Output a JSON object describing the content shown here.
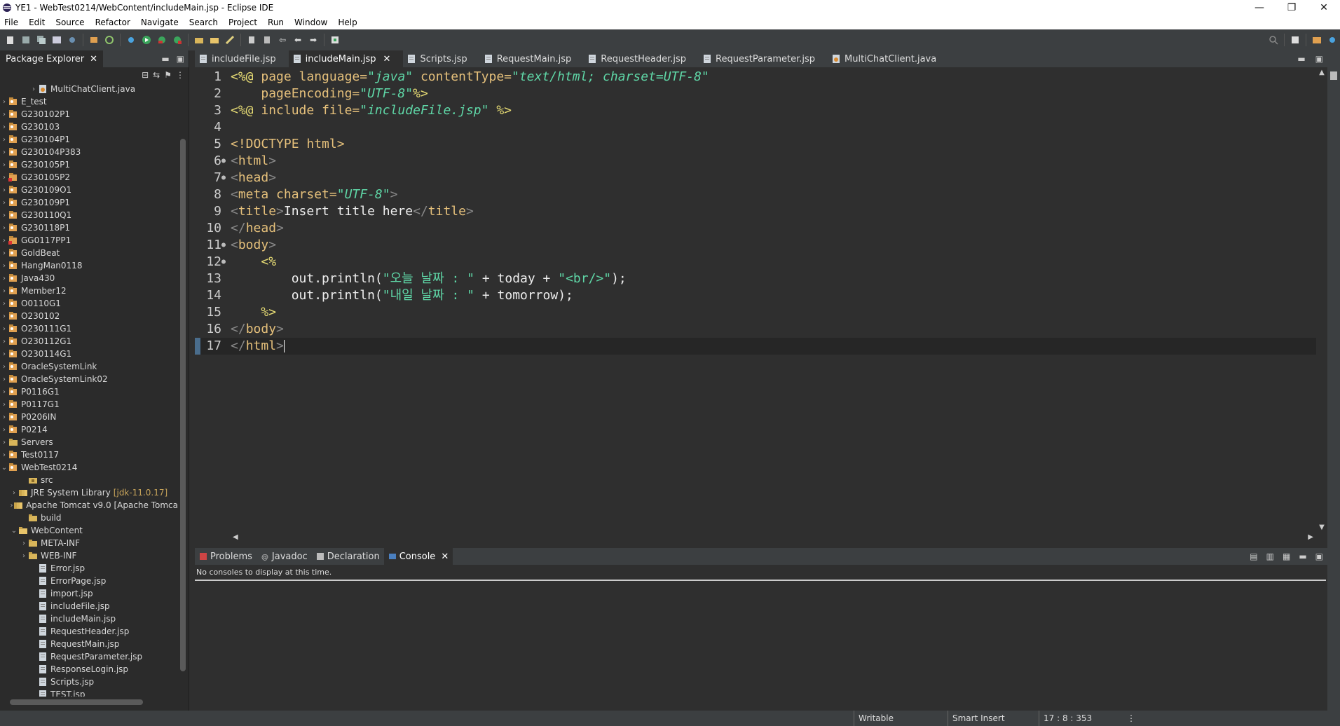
{
  "window": {
    "title": "YE1 - WebTest0214/WebContent/includeMain.jsp - Eclipse IDE",
    "controls": {
      "minimize": "—",
      "restore": "❐",
      "close": "✕"
    }
  },
  "menu": [
    "File",
    "Edit",
    "Source",
    "Refactor",
    "Navigate",
    "Search",
    "Project",
    "Run",
    "Window",
    "Help"
  ],
  "explorer": {
    "tab_label": "Package Explorer",
    "close_glyph": "✕",
    "tree": [
      {
        "label": "MultiChatClient.java",
        "indent": 3,
        "arrow": "›",
        "icon": "java-file-icon"
      },
      {
        "label": "E_test",
        "indent": 0,
        "arrow": "›",
        "icon": "project-icon"
      },
      {
        "label": "G230102P1",
        "indent": 0,
        "arrow": "›",
        "icon": "project-icon"
      },
      {
        "label": "G230103",
        "indent": 0,
        "arrow": "›",
        "icon": "project-icon"
      },
      {
        "label": "G230104P1",
        "indent": 0,
        "arrow": "›",
        "icon": "project-icon"
      },
      {
        "label": "G230104P383",
        "indent": 0,
        "arrow": "›",
        "icon": "project-icon"
      },
      {
        "label": "G230105P1",
        "indent": 0,
        "arrow": "›",
        "icon": "project-icon"
      },
      {
        "label": "G230105P2",
        "indent": 0,
        "arrow": "›",
        "icon": "project-error-icon"
      },
      {
        "label": "G230109O1",
        "indent": 0,
        "arrow": "›",
        "icon": "project-icon"
      },
      {
        "label": "G230109P1",
        "indent": 0,
        "arrow": "›",
        "icon": "project-icon"
      },
      {
        "label": "G230110Q1",
        "indent": 0,
        "arrow": "›",
        "icon": "project-icon"
      },
      {
        "label": "G230118P1",
        "indent": 0,
        "arrow": "›",
        "icon": "project-icon"
      },
      {
        "label": "GG0117PP1",
        "indent": 0,
        "arrow": "›",
        "icon": "project-error-icon"
      },
      {
        "label": "GoldBeat",
        "indent": 0,
        "arrow": "›",
        "icon": "project-icon"
      },
      {
        "label": "HangMan0118",
        "indent": 0,
        "arrow": "›",
        "icon": "project-icon"
      },
      {
        "label": "Java430",
        "indent": 0,
        "arrow": "›",
        "icon": "project-icon"
      },
      {
        "label": "Member12",
        "indent": 0,
        "arrow": "›",
        "icon": "project-icon"
      },
      {
        "label": "O0110G1",
        "indent": 0,
        "arrow": "›",
        "icon": "project-icon"
      },
      {
        "label": "O230102",
        "indent": 0,
        "arrow": "›",
        "icon": "project-icon"
      },
      {
        "label": "O230111G1",
        "indent": 0,
        "arrow": "›",
        "icon": "project-icon"
      },
      {
        "label": "O230112G1",
        "indent": 0,
        "arrow": "›",
        "icon": "project-icon"
      },
      {
        "label": "O230114G1",
        "indent": 0,
        "arrow": "›",
        "icon": "project-icon"
      },
      {
        "label": "OracleSystemLink",
        "indent": 0,
        "arrow": "›",
        "icon": "project-icon"
      },
      {
        "label": "OracleSystemLink02",
        "indent": 0,
        "arrow": "›",
        "icon": "project-icon"
      },
      {
        "label": "P0116G1",
        "indent": 0,
        "arrow": "›",
        "icon": "project-icon"
      },
      {
        "label": "P0117G1",
        "indent": 0,
        "arrow": "›",
        "icon": "project-icon"
      },
      {
        "label": "P0206IN",
        "indent": 0,
        "arrow": "›",
        "icon": "project-icon"
      },
      {
        "label": "P0214",
        "indent": 0,
        "arrow": "›",
        "icon": "project-icon"
      },
      {
        "label": "Servers",
        "indent": 0,
        "arrow": "›",
        "icon": "folder-icon"
      },
      {
        "label": "Test0117",
        "indent": 0,
        "arrow": "›",
        "icon": "project-icon"
      },
      {
        "label": "WebTest0214",
        "indent": 0,
        "arrow": "⌄",
        "icon": "project-icon"
      },
      {
        "label": "src",
        "indent": 2,
        "arrow": "",
        "icon": "package-folder-icon"
      },
      {
        "label": "JRE System Library",
        "decor": "[jdk-11.0.17]",
        "indent": 1,
        "arrow": "›",
        "icon": "library-icon"
      },
      {
        "label": "Apache Tomcat v9.0 [Apache Tomca",
        "indent": 1,
        "arrow": "›",
        "icon": "library-icon"
      },
      {
        "label": "build",
        "indent": 2,
        "arrow": "",
        "icon": "folder-icon"
      },
      {
        "label": "WebContent",
        "indent": 1,
        "arrow": "⌄",
        "icon": "folder-open-icon"
      },
      {
        "label": "META-INF",
        "indent": 2,
        "arrow": "›",
        "icon": "folder-icon"
      },
      {
        "label": "WEB-INF",
        "indent": 2,
        "arrow": "›",
        "icon": "folder-icon"
      },
      {
        "label": "Error.jsp",
        "indent": 3,
        "arrow": "",
        "icon": "jsp-file-icon"
      },
      {
        "label": "ErrorPage.jsp",
        "indent": 3,
        "arrow": "",
        "icon": "jsp-file-icon"
      },
      {
        "label": "import.jsp",
        "indent": 3,
        "arrow": "",
        "icon": "jsp-file-icon"
      },
      {
        "label": "includeFile.jsp",
        "indent": 3,
        "arrow": "",
        "icon": "jsp-file-icon"
      },
      {
        "label": "includeMain.jsp",
        "indent": 3,
        "arrow": "",
        "icon": "jsp-file-icon"
      },
      {
        "label": "RequestHeader.jsp",
        "indent": 3,
        "arrow": "",
        "icon": "jsp-file-icon"
      },
      {
        "label": "RequestMain.jsp",
        "indent": 3,
        "arrow": "",
        "icon": "jsp-file-icon"
      },
      {
        "label": "RequestParameter.jsp",
        "indent": 3,
        "arrow": "",
        "icon": "jsp-file-icon"
      },
      {
        "label": "ResponseLogin.jsp",
        "indent": 3,
        "arrow": "",
        "icon": "jsp-file-icon"
      },
      {
        "label": "Scripts.jsp",
        "indent": 3,
        "arrow": "",
        "icon": "jsp-file-icon"
      },
      {
        "label": "TEST.jsp",
        "indent": 3,
        "arrow": "",
        "icon": "jsp-file-icon"
      }
    ]
  },
  "editor": {
    "tabs": [
      {
        "label": "includeFile.jsp",
        "active": false,
        "icon": "jsp-file-icon"
      },
      {
        "label": "includeMain.jsp",
        "active": true,
        "icon": "jsp-file-icon"
      },
      {
        "label": "Scripts.jsp",
        "active": false,
        "icon": "jsp-file-icon"
      },
      {
        "label": "RequestMain.jsp",
        "active": false,
        "icon": "jsp-file-icon"
      },
      {
        "label": "RequestHeader.jsp",
        "active": false,
        "icon": "jsp-file-icon"
      },
      {
        "label": "RequestParameter.jsp",
        "active": false,
        "icon": "jsp-file-icon"
      },
      {
        "label": "MultiChatClient.java",
        "active": false,
        "icon": "java-file-icon"
      }
    ],
    "close_glyph": "✕",
    "lines": [
      {
        "num": "1",
        "fold": "",
        "tokens": [
          [
            "dir",
            "<%@ "
          ],
          [
            "tag",
            "page "
          ],
          [
            "attr",
            "language="
          ],
          [
            "val",
            "\"java\" "
          ],
          [
            "attr",
            "contentType="
          ],
          [
            "val",
            "\"text/html; charset=UTF-8\""
          ]
        ]
      },
      {
        "num": "2",
        "fold": "",
        "tokens": [
          [
            "plain",
            "    "
          ],
          [
            "attr",
            "pageEncoding="
          ],
          [
            "val",
            "\"UTF-8\""
          ],
          [
            "dir",
            "%>"
          ]
        ]
      },
      {
        "num": "3",
        "fold": "",
        "tokens": [
          [
            "dir",
            "<%@ "
          ],
          [
            "tag",
            "include "
          ],
          [
            "attr",
            "file="
          ],
          [
            "val",
            "\"includeFile.jsp\" "
          ],
          [
            "dir",
            "%>"
          ]
        ]
      },
      {
        "num": "4",
        "fold": "",
        "tokens": []
      },
      {
        "num": "5",
        "fold": "",
        "tokens": [
          [
            "tag",
            "<!DOCTYPE "
          ],
          [
            "attr",
            "html"
          ],
          [
            "tag",
            ">"
          ]
        ]
      },
      {
        "num": "6",
        "fold": "●",
        "tokens": [
          [
            "bracket",
            "<"
          ],
          [
            "tag",
            "html"
          ],
          [
            "bracket",
            ">"
          ]
        ]
      },
      {
        "num": "7",
        "fold": "●",
        "tokens": [
          [
            "bracket",
            "<"
          ],
          [
            "tag",
            "head"
          ],
          [
            "bracket",
            ">"
          ]
        ]
      },
      {
        "num": "8",
        "fold": "",
        "tokens": [
          [
            "bracket",
            "<"
          ],
          [
            "tag",
            "meta "
          ],
          [
            "attr",
            "charset="
          ],
          [
            "val",
            "\"UTF-8\""
          ],
          [
            "bracket",
            ">"
          ]
        ]
      },
      {
        "num": "9",
        "fold": "",
        "tokens": [
          [
            "bracket",
            "<"
          ],
          [
            "tag",
            "title"
          ],
          [
            "bracket",
            ">"
          ],
          [
            "plain",
            "Insert title here"
          ],
          [
            "bracket",
            "</"
          ],
          [
            "tag",
            "title"
          ],
          [
            "bracket",
            ">"
          ]
        ]
      },
      {
        "num": "10",
        "fold": "",
        "tokens": [
          [
            "bracket",
            "</"
          ],
          [
            "tag",
            "head"
          ],
          [
            "bracket",
            ">"
          ]
        ]
      },
      {
        "num": "11",
        "fold": "●",
        "tokens": [
          [
            "bracket",
            "<"
          ],
          [
            "tag",
            "body"
          ],
          [
            "bracket",
            ">"
          ]
        ]
      },
      {
        "num": "12",
        "fold": "●",
        "tokens": [
          [
            "plain",
            "    "
          ],
          [
            "dir",
            "<%"
          ]
        ]
      },
      {
        "num": "13",
        "fold": "",
        "tokens": [
          [
            "plain",
            "        out.println("
          ],
          [
            "str",
            "\"오늘 날짜 : \""
          ],
          [
            "plain",
            " + today + "
          ],
          [
            "str",
            "\"<br/>\""
          ],
          [
            "plain",
            ");"
          ]
        ]
      },
      {
        "num": "14",
        "fold": "",
        "tokens": [
          [
            "plain",
            "        out.println("
          ],
          [
            "str",
            "\"내일 날짜 : \""
          ],
          [
            "plain",
            " + tomorrow);"
          ]
        ]
      },
      {
        "num": "15",
        "fold": "",
        "tokens": [
          [
            "plain",
            "    "
          ],
          [
            "dir",
            "%>"
          ]
        ]
      },
      {
        "num": "16",
        "fold": "",
        "tokens": [
          [
            "bracket",
            "</"
          ],
          [
            "tag",
            "body"
          ],
          [
            "bracket",
            ">"
          ]
        ]
      },
      {
        "num": "17",
        "fold": "",
        "current": true,
        "tokens": [
          [
            "bracket",
            "</"
          ],
          [
            "tag",
            "html"
          ],
          [
            "bracket",
            ">"
          ]
        ]
      }
    ]
  },
  "console": {
    "tabs": [
      {
        "label": "Problems",
        "active": false,
        "icon": "problems-icon"
      },
      {
        "label": "Javadoc",
        "active": false,
        "icon": "javadoc-icon"
      },
      {
        "label": "Declaration",
        "active": false,
        "icon": "declaration-icon"
      },
      {
        "label": "Console",
        "active": true,
        "icon": "console-icon"
      }
    ],
    "close_glyph": "✕",
    "message": "No consoles to display at this time."
  },
  "status": {
    "writable": "Writable",
    "insert_mode": "Smart Insert",
    "position": "17 : 8 : 353"
  },
  "colors": {
    "accent": "#4a6d8c",
    "project_icon": "#e0a050",
    "folder_icon": "#d8b55a"
  }
}
